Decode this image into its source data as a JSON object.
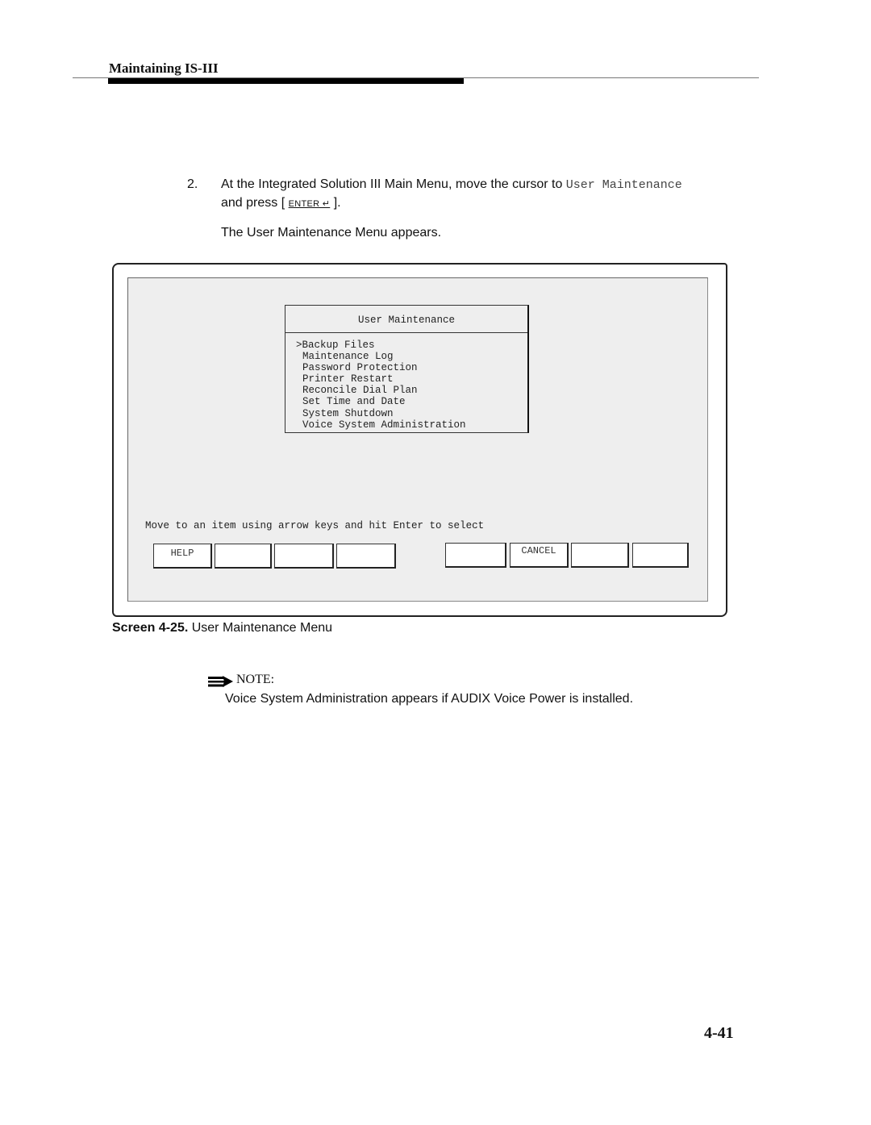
{
  "header": {
    "title": "Maintaining IS-III"
  },
  "step": {
    "number": "2.",
    "text_before": "At the Integrated Solution III Main Menu, move the cursor to ",
    "mono_option": "User Maintenance",
    "text_mid": " and press [ ",
    "key_label": "ENTER ↵",
    "text_after": " ]."
  },
  "result_text": "The User Maintenance Menu appears.",
  "screen": {
    "menu_title": "User Maintenance",
    "menu_items": [
      {
        "label": ">Backup Files",
        "selected": true
      },
      {
        "label": "Maintenance Log"
      },
      {
        "label": "Password Protection"
      },
      {
        "label": "Printer Restart"
      },
      {
        "label": "Reconcile Dial Plan"
      },
      {
        "label": "Set Time and Date"
      },
      {
        "label": "System Shutdown"
      },
      {
        "label": "Voice System Administration"
      }
    ],
    "hint": "Move to an item using arrow keys and hit Enter to select",
    "function_keys": [
      "HELP",
      "",
      "",
      "",
      "",
      "CANCEL",
      "",
      ""
    ]
  },
  "caption": {
    "label": "Screen 4-25.",
    "text": " User Maintenance Menu"
  },
  "note": {
    "icon": "note-arrow-icon",
    "label": "NOTE:",
    "text": "Voice System Administration appears if AUDIX Voice Power is installed."
  },
  "page_number": "4-41"
}
